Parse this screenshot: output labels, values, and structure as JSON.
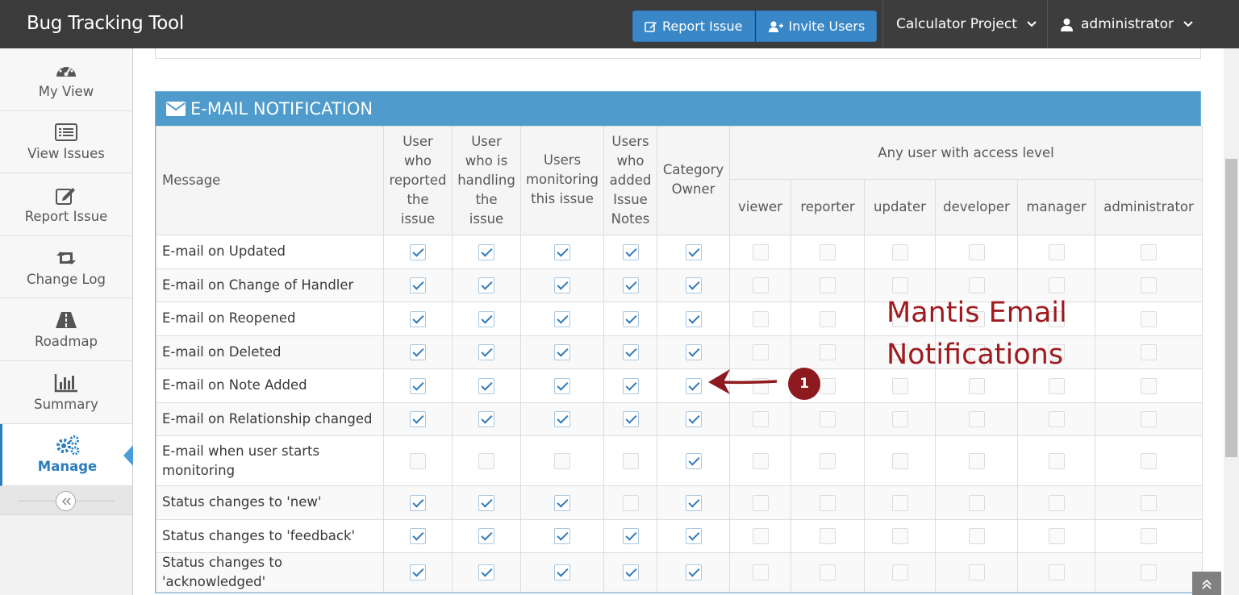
{
  "navbar": {
    "brand": "Bug Tracking Tool",
    "report_issue": "Report Issue",
    "invite_users": "Invite Users",
    "project": "Calculator Project",
    "user": "administrator"
  },
  "sidebar": {
    "items": [
      {
        "label": "My View",
        "icon": "tachometer-icon"
      },
      {
        "label": "View Issues",
        "icon": "list-icon"
      },
      {
        "label": "Report Issue",
        "icon": "edit-icon"
      },
      {
        "label": "Change Log",
        "icon": "retweet-icon"
      },
      {
        "label": "Roadmap",
        "icon": "road-icon"
      },
      {
        "label": "Summary",
        "icon": "bar-chart-icon"
      },
      {
        "label": "Manage",
        "icon": "gears-icon",
        "active": true
      }
    ],
    "collapse_icon": "double-chevron-left-icon"
  },
  "widget": {
    "title": "E-MAIL NOTIFICATION",
    "icon": "envelope-icon"
  },
  "table": {
    "message_header": "Message",
    "columns": [
      "User who reported the issue",
      "User who is handling the issue",
      "Users monitoring this issue",
      "Users who added Issue Notes",
      "Category Owner"
    ],
    "column_lines": [
      [
        "User",
        "who",
        "reported",
        "the",
        "issue"
      ],
      [
        "User",
        "who is",
        "handling",
        "the",
        "issue"
      ],
      [
        "Users",
        "monitoring",
        "this issue"
      ],
      [
        "Users",
        "who",
        "added",
        "Issue",
        "Notes"
      ],
      [
        "Category",
        "Owner"
      ]
    ],
    "access_header": "Any user with access level",
    "access_levels": [
      "viewer",
      "reporter",
      "updater",
      "developer",
      "manager",
      "administrator"
    ],
    "rows": [
      {
        "message": "E-mail on Updated",
        "checks": [
          1,
          1,
          1,
          1,
          1,
          0,
          0,
          0,
          0,
          0,
          0
        ]
      },
      {
        "message": "E-mail on Change of Handler",
        "checks": [
          1,
          1,
          1,
          1,
          1,
          0,
          0,
          0,
          0,
          0,
          0
        ]
      },
      {
        "message": "E-mail on Reopened",
        "checks": [
          1,
          1,
          1,
          1,
          1,
          0,
          0,
          0,
          0,
          0,
          0
        ]
      },
      {
        "message": "E-mail on Deleted",
        "checks": [
          1,
          1,
          1,
          1,
          1,
          0,
          0,
          0,
          0,
          0,
          0
        ]
      },
      {
        "message": "E-mail on Note Added",
        "checks": [
          1,
          1,
          1,
          1,
          1,
          0,
          0,
          0,
          0,
          0,
          0
        ]
      },
      {
        "message": "E-mail on Relationship changed",
        "checks": [
          1,
          1,
          1,
          1,
          1,
          0,
          0,
          0,
          0,
          0,
          0
        ]
      },
      {
        "message": "E-mail when user starts monitoring",
        "checks": [
          0,
          0,
          0,
          0,
          1,
          0,
          0,
          0,
          0,
          0,
          0
        ]
      },
      {
        "message": "Status changes to 'new'",
        "checks": [
          1,
          1,
          1,
          0,
          1,
          0,
          0,
          0,
          0,
          0,
          0
        ]
      },
      {
        "message": "Status changes to 'feedback'",
        "checks": [
          1,
          1,
          1,
          1,
          1,
          0,
          0,
          0,
          0,
          0,
          0
        ]
      },
      {
        "message": "Status changes to 'acknowledged'",
        "checks": [
          1,
          1,
          1,
          1,
          1,
          0,
          0,
          0,
          0,
          0,
          0
        ]
      }
    ]
  },
  "annotation": {
    "text_line1": "Mantis Email",
    "text_line2": "Notifications",
    "marker": "1",
    "color": "#9e1a1f"
  },
  "scroll": {
    "back_to_top_icon": "double-chevron-up-icon"
  }
}
